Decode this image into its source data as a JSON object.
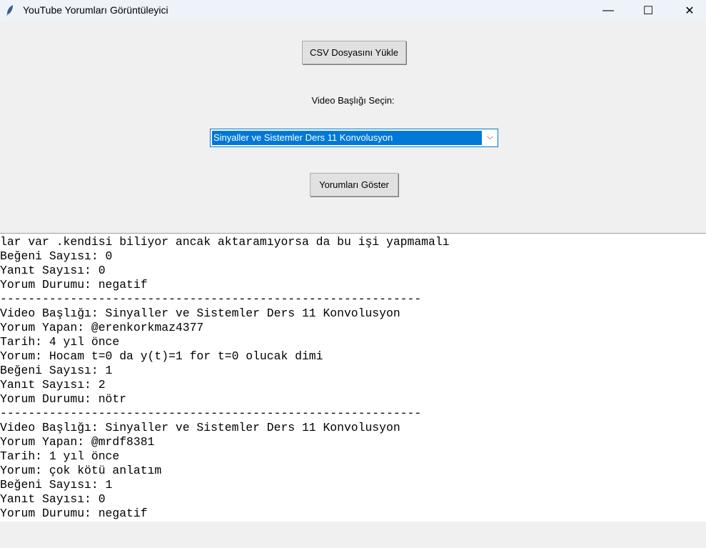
{
  "window": {
    "title": "YouTube Yorumları Görüntüleyici",
    "minimize": "—",
    "maximize": "☐",
    "close": "✕"
  },
  "load_button": "CSV Dosyasını Yükle",
  "video_label": "Video Başlığı Seçin:",
  "video_select": {
    "value": "Sinyaller ve Sistemler Ders 11 Konvolusyon",
    "chevron": "⌵"
  },
  "show_button": "Yorumları Göster",
  "output_lines": [
    "lar var .kendisi biliyor ancak aktaramıyorsa da bu işi yapmamalı",
    "Beğeni Sayısı: 0",
    "Yanıt Sayısı: 0",
    "Yorum Durumu: negatif",
    "------------------------------------------------------------",
    "Video Başlığı: Sinyaller ve Sistemler Ders 11 Konvolusyon",
    "Yorum Yapan: @erenkorkmaz4377",
    "Tarih: 4 yıl önce",
    "Yorum: Hocam t=0 da y(t)=1 for t=0 olucak dimi",
    "Beğeni Sayısı: 1",
    "Yanıt Sayısı: 2",
    "Yorum Durumu: nötr",
    "------------------------------------------------------------",
    "Video Başlığı: Sinyaller ve Sistemler Ders 11 Konvolusyon",
    "Yorum Yapan: @mrdf8381",
    "Tarih: 1 yıl önce",
    "Yorum: çok kötü anlatım",
    "Beğeni Sayısı: 1",
    "Yanıt Sayısı: 0",
    "Yorum Durumu: negatif"
  ]
}
